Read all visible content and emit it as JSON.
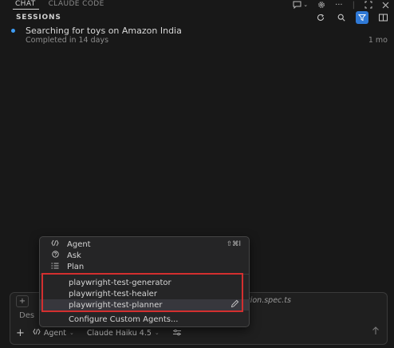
{
  "topbar": {
    "tabs": [
      {
        "label": "CHAT",
        "active": true
      },
      {
        "label": "CLAUDE CODE",
        "active": false
      }
    ],
    "icons": [
      "new-chat-icon",
      "chevron-down-icon",
      "gear-icon",
      "more-icon",
      "maximize-icon",
      "close-icon"
    ],
    "more_label": "···"
  },
  "sessions": {
    "title": "SESSIONS",
    "actions": [
      "refresh-icon",
      "search-icon",
      "filter-icon",
      "split-panel-icon"
    ],
    "items": [
      {
        "title": "Searching for toys on Amazon India",
        "subtitle": "Completed in 14 days",
        "age": "1 mo",
        "status_color": "#3e9df5"
      }
    ]
  },
  "menu": {
    "modes": [
      {
        "icon": "agent-icon",
        "label": "Agent",
        "shortcut": "⇧⌘I"
      },
      {
        "icon": "ask-icon",
        "label": "Ask",
        "shortcut": ""
      },
      {
        "icon": "plan-icon",
        "label": "Plan",
        "shortcut": ""
      }
    ],
    "custom_agents": [
      {
        "label": "playwright-test-generator"
      },
      {
        "label": "playwright-test-healer"
      },
      {
        "label": "playwright-test-planner"
      }
    ],
    "configure_label": "Configure Custom Agents..."
  },
  "input": {
    "context_plus": "+",
    "file_chip": "tion.spec.ts",
    "description": "Des",
    "add_label": "+",
    "agent_label": "Agent",
    "model_label": "Claude Haiku 4.5"
  },
  "colors": {
    "accent": "#2f79d6",
    "highlight": "#d32f2f",
    "status_dot": "#3e9df5"
  }
}
